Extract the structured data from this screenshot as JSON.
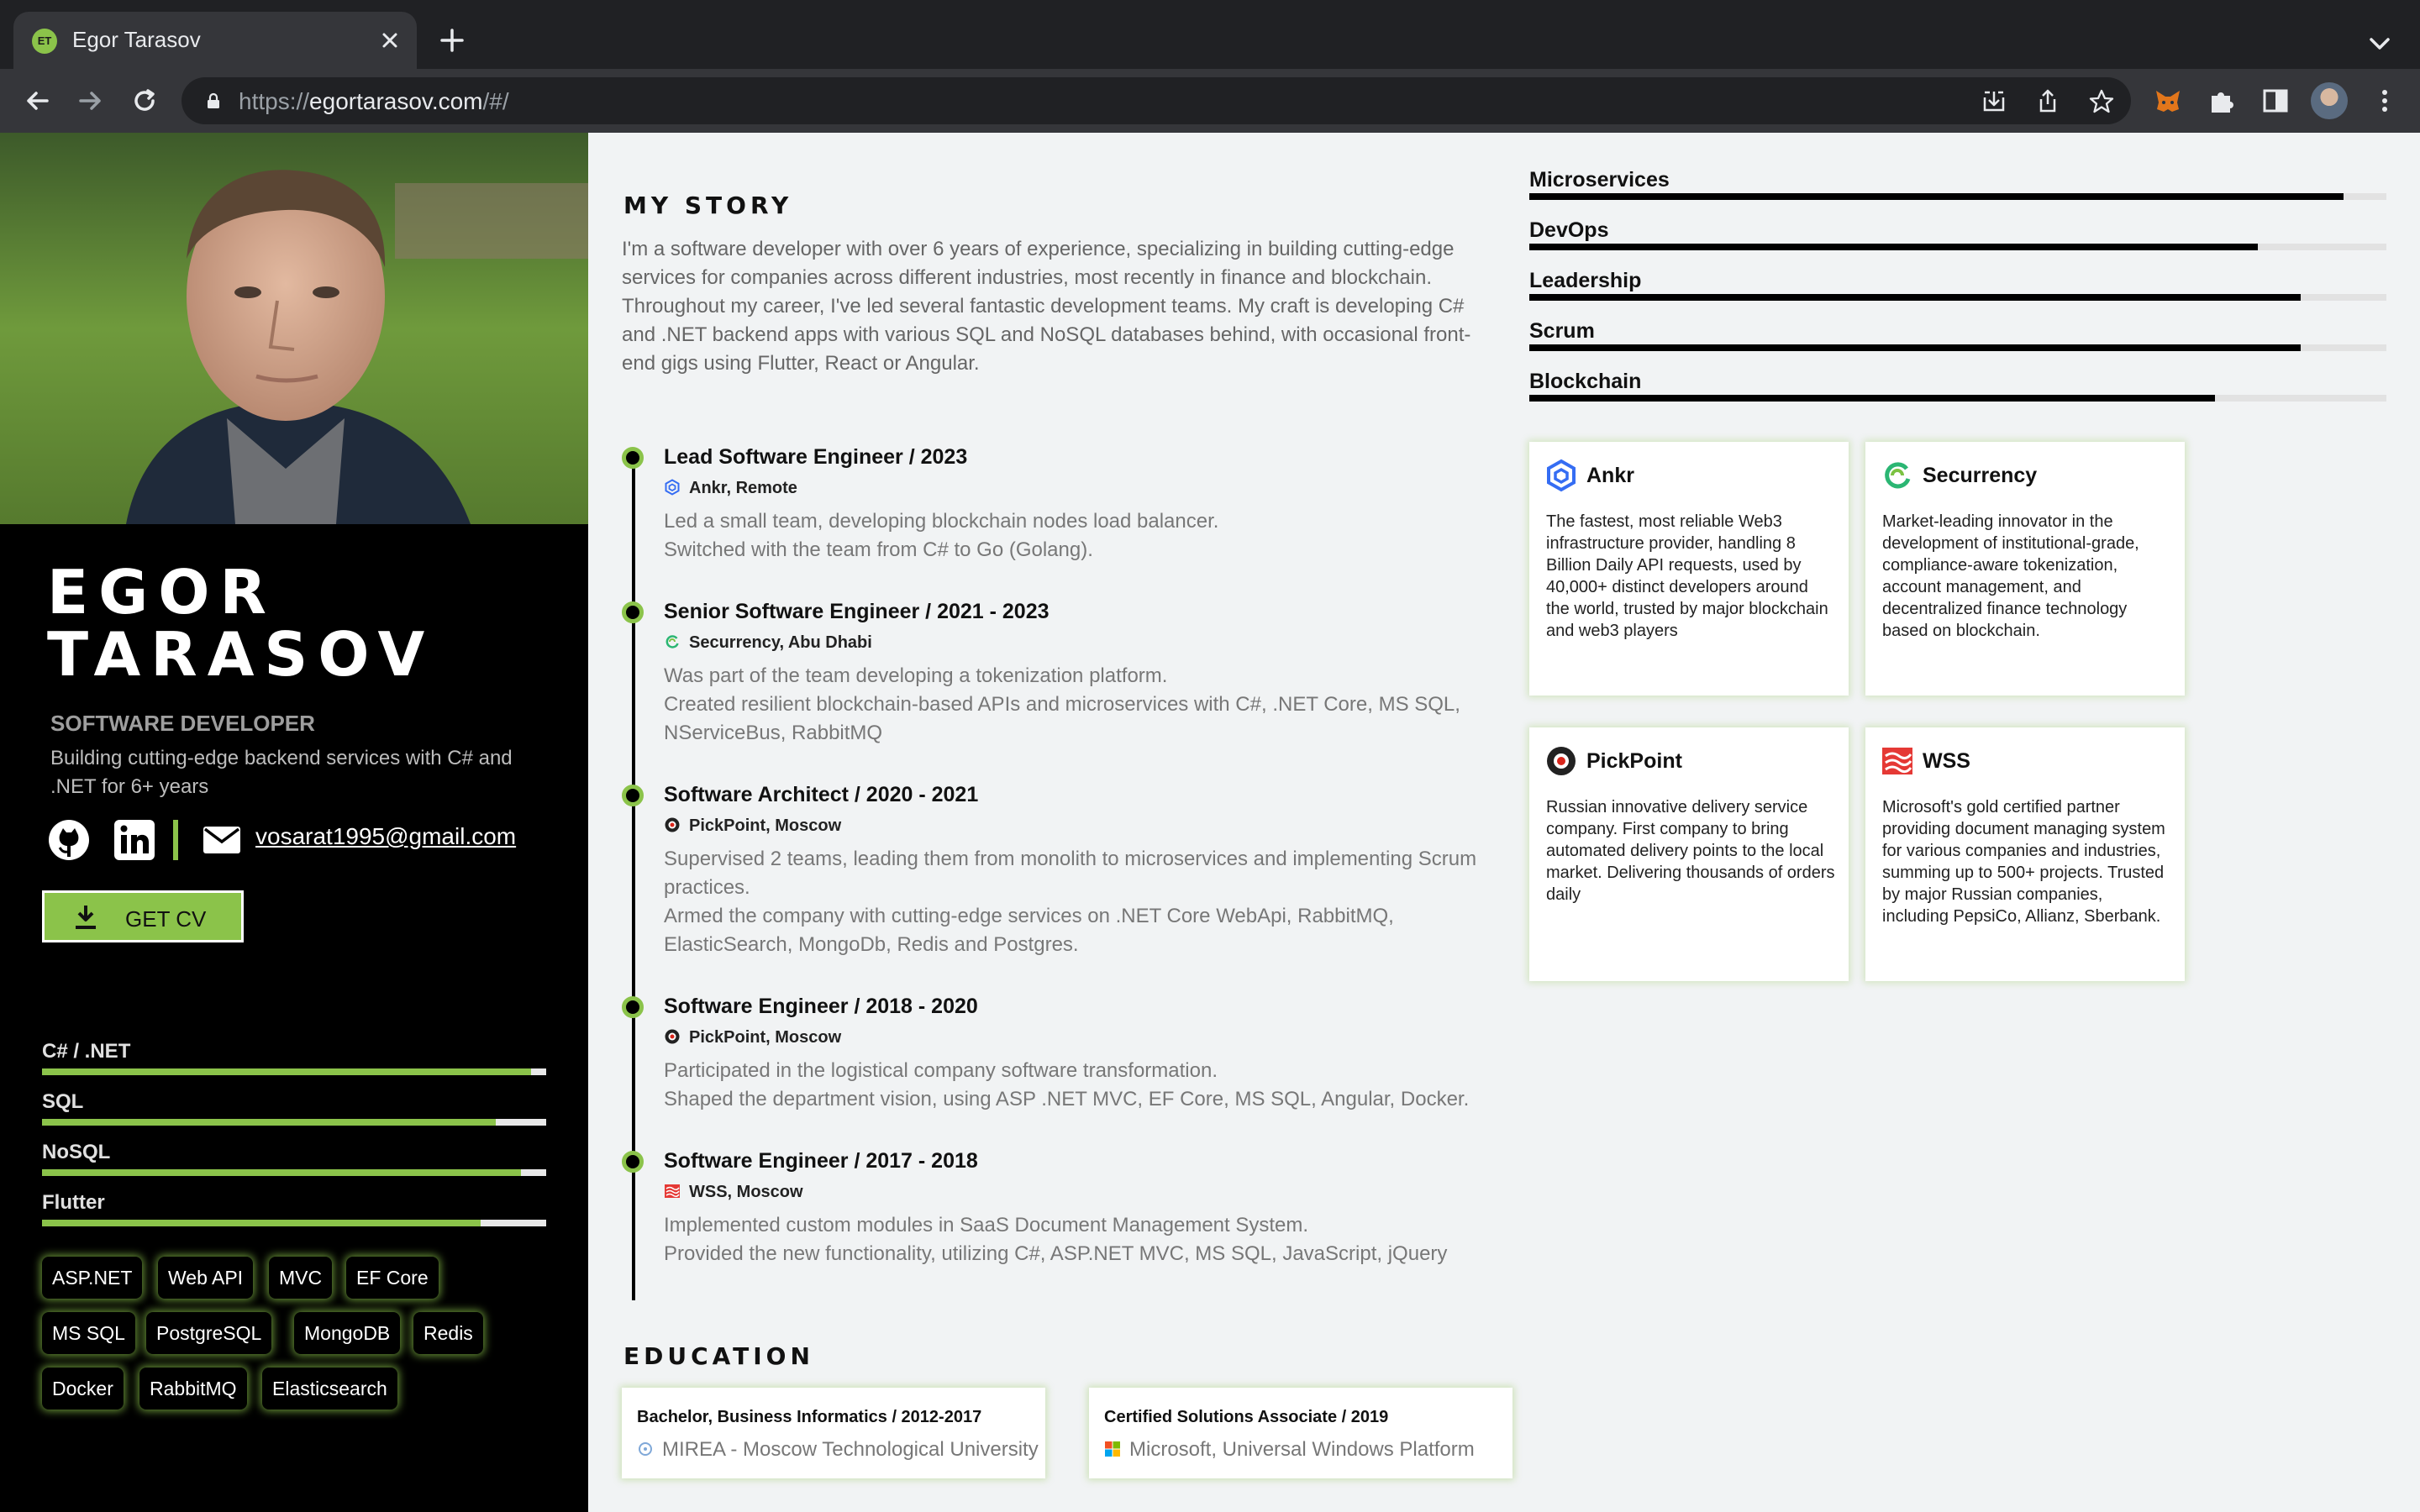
{
  "browser": {
    "tab_title": "Egor Tarasov",
    "tab_favicon_text": "ET",
    "url_scheme": "https://",
    "url_host": "egortarasov.com",
    "url_path": "/#/"
  },
  "profile": {
    "name_first": "EGOR",
    "name_last": "TARASOV",
    "role": "SOFTWARE DEVELOPER",
    "tagline": "Building cutting-edge backend services with C# and .NET for 6+ years",
    "email": "vosarat1995@gmail.com",
    "cv_button": "GET CV"
  },
  "left_skills": [
    {
      "label": "C# / .NET",
      "level": 0.97
    },
    {
      "label": "SQL",
      "level": 0.9
    },
    {
      "label": "NoSQL",
      "level": 0.95
    },
    {
      "label": "Flutter",
      "level": 0.87
    }
  ],
  "chips": [
    "ASP.NET",
    "Web API",
    "MVC",
    "EF Core",
    "MS SQL",
    "PostgreSQL",
    "MongoDB",
    "Redis",
    "Docker",
    "RabbitMQ",
    "Elasticsearch"
  ],
  "story": {
    "heading": "MY STORY",
    "text": "I'm a software developer with over 6 years of experience, specializing in building cutting-edge services for companies across different industries, most recently in finance and blockchain. Throughout my career, I've led several fantastic development teams. My craft is developing C# and .NET backend apps with various SQL and NoSQL databases behind, with occasional front-end gigs using Flutter, React or Angular."
  },
  "jobs": [
    {
      "title": "Lead Software Engineer / 2023",
      "company": "Ankr, Remote",
      "icon": "ankr-logo-icon",
      "lines": [
        "Led a small team, developing blockchain nodes load balancer.",
        "Switched with the team from C# to Go (Golang)."
      ]
    },
    {
      "title": "Senior Software Engineer / 2021 - 2023",
      "company": "Securrency, Abu Dhabi",
      "icon": "securrency-logo-icon",
      "lines": [
        "Was part of the team developing a tokenization platform.",
        "Created resilient blockchain-based APIs and microservices with C#, .NET Core, MS SQL, NServiceBus, RabbitMQ"
      ]
    },
    {
      "title": "Software Architect / 2020 - 2021",
      "company": "PickPoint, Moscow",
      "icon": "pickpoint-logo-icon",
      "lines": [
        "Supervised 2 teams, leading them from monolith to microservices and implementing Scrum practices.",
        "Armed the company with cutting-edge services on .NET Core WebApi, RabbitMQ, ElasticSearch, MongoDb, Redis and Postgres."
      ]
    },
    {
      "title": "Software Engineer / 2018 - 2020",
      "company": "PickPoint, Moscow",
      "icon": "pickpoint-logo-icon",
      "lines": [
        "Participated in the logistical company software transformation.",
        "Shaped the department vision, using ASP .NET MVC, EF Core, MS SQL, Angular, Docker."
      ]
    },
    {
      "title": "Software Engineer / 2017 - 2018",
      "company": "WSS, Moscow",
      "icon": "wss-logo-icon",
      "lines": [
        "Implemented custom modules in SaaS Document Management System.",
        "Provided the new functionality, utilizing C#, ASP.NET MVC, MS SQL, JavaScript, jQuery"
      ]
    }
  ],
  "education": {
    "heading": "EDUCATION",
    "items": [
      {
        "title": "Bachelor, Business Informatics / 2012-2017",
        "school": "MIREA - Moscow Technological University",
        "icon": "mirea-logo-icon"
      },
      {
        "title": "Certified Solutions Associate / 2019",
        "school": "Microsoft, Universal Windows Platform",
        "icon": "microsoft-logo-icon"
      }
    ]
  },
  "right_skills": [
    {
      "label": "Microservices",
      "level": 0.95
    },
    {
      "label": "DevOps",
      "level": 0.85
    },
    {
      "label": "Leadership",
      "level": 0.9
    },
    {
      "label": "Scrum",
      "level": 0.9
    },
    {
      "label": "Blockchain",
      "level": 0.8
    }
  ],
  "companies": [
    {
      "name": "Ankr",
      "icon": "ankr-logo-icon",
      "text": "The fastest, most reliable Web3 infrastructure provider, handling 8 Billion Daily API requests, used by 40,000+ distinct developers around the world, trusted by major blockchain and web3 players"
    },
    {
      "name": "Securrency",
      "icon": "securrency-logo-icon",
      "text": "Market-leading innovator in the development of institutional-grade, compliance-aware tokenization, account management, and decentralized finance technology based on blockchain."
    },
    {
      "name": "PickPoint",
      "icon": "pickpoint-logo-icon",
      "text": "Russian innovative delivery service company. First company to bring automated delivery points to the local market. Delivering thousands of orders daily"
    },
    {
      "name": "WSS",
      "icon": "wss-logo-icon",
      "text": "Microsoft's gold certified partner providing document managing system for various companies and industries, summing up to 500+ projects. Trusted by major Russian companies, including PepsiCo, Allianz, Sberbank."
    }
  ],
  "colors": {
    "accent": "#8bc34a",
    "sidebar_bg": "#000000",
    "page_bg": "#f1f3f4",
    "chrome_dark": "#202124",
    "chrome_tab": "#35363a"
  }
}
